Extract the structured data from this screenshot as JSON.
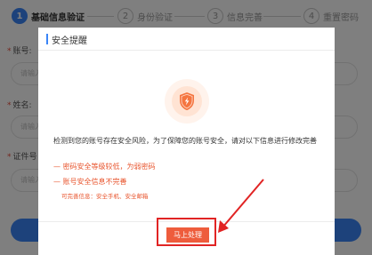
{
  "steps": [
    {
      "num": "1",
      "label": "基础信息验证"
    },
    {
      "num": "2",
      "label": "身份验证"
    },
    {
      "num": "3",
      "label": "信息完善"
    },
    {
      "num": "4",
      "label": "重置密码"
    }
  ],
  "form": {
    "account_label": "账号:",
    "account_placeholder": "请输入",
    "name_label": "姓名:",
    "name_placeholder": "请输入",
    "id_label": "证件号",
    "id_placeholder": "请输入"
  },
  "modal": {
    "title": "安全提醒",
    "message": "检测到您的账号存在安全风险，为了保障您的账号安全，请对以下信息进行修改完善",
    "risks": [
      "— 密码安全等级较低，为弱密码",
      "— 账号安全信息不完善"
    ],
    "hint": "可完善信息：安全手机、安全邮箱",
    "handle_button": "马上处理"
  },
  "colors": {
    "accent": "#3a85f7",
    "warning": "#e8542d",
    "button": "#ee5c3c",
    "annotation": "#e12424"
  },
  "icons": {
    "modal_icon": "shield-lightning-icon"
  }
}
